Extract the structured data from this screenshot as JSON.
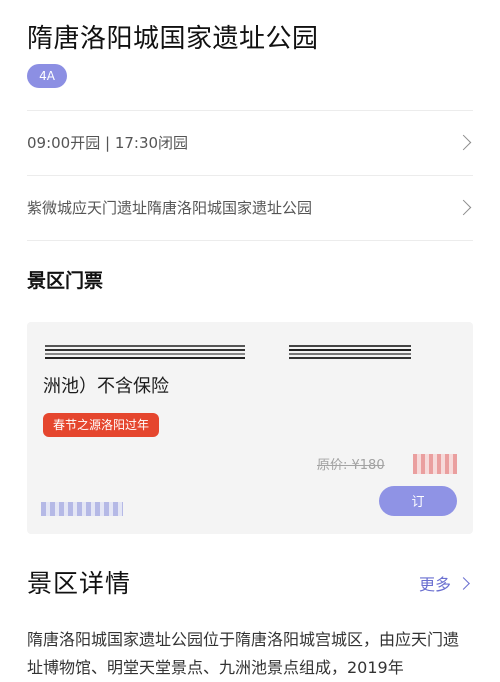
{
  "scenic": {
    "title": "隋唐洛阳城国家遗址公园",
    "rating": "4A"
  },
  "rows": {
    "hours": "09:00开园 | 17:30闭园",
    "address": "紫微城应天门遗址隋唐洛阳城国家遗址公园"
  },
  "tickets": {
    "section_title": "景区门票",
    "ticket_name_visible": "洲池）不含保险",
    "promo_tag": "春节之源洛阳过年",
    "original_price": "原价: ¥180",
    "book_label": "订"
  },
  "details": {
    "section_title": "景区详情",
    "more_label": "更多",
    "intro": "隋唐洛阳城国家遗址公园位于隋唐洛阳城宫城区，由应天门遗址博物馆、明堂天堂景点、九洲池景点组成，2019年"
  },
  "colors": {
    "accent": "#8c8fe3",
    "promo": "#e5462e",
    "link": "#6a6fd0"
  }
}
